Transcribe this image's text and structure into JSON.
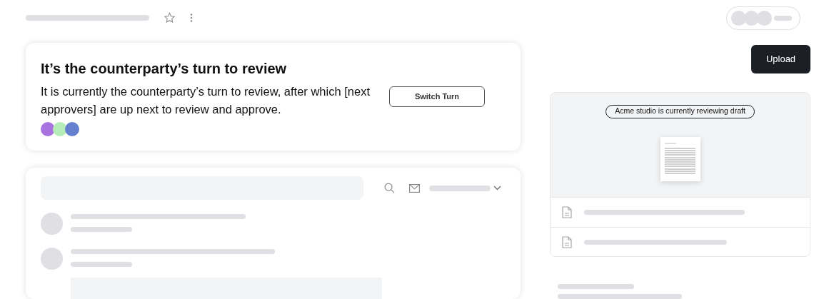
{
  "turn_card": {
    "title": "It’s the counterparty’s turn to review",
    "message": "It is currently the counterparty’s turn to review, after which [next approvers] are up next to review and approve.",
    "approvers": [
      {
        "color": "#a973df"
      },
      {
        "color": "#b6ecb8"
      },
      {
        "color": "#6580cf"
      }
    ],
    "button": "Switch Turn"
  },
  "upload_button": "Upload",
  "preview": {
    "status": "Acme studio is currently reviewing draft"
  }
}
